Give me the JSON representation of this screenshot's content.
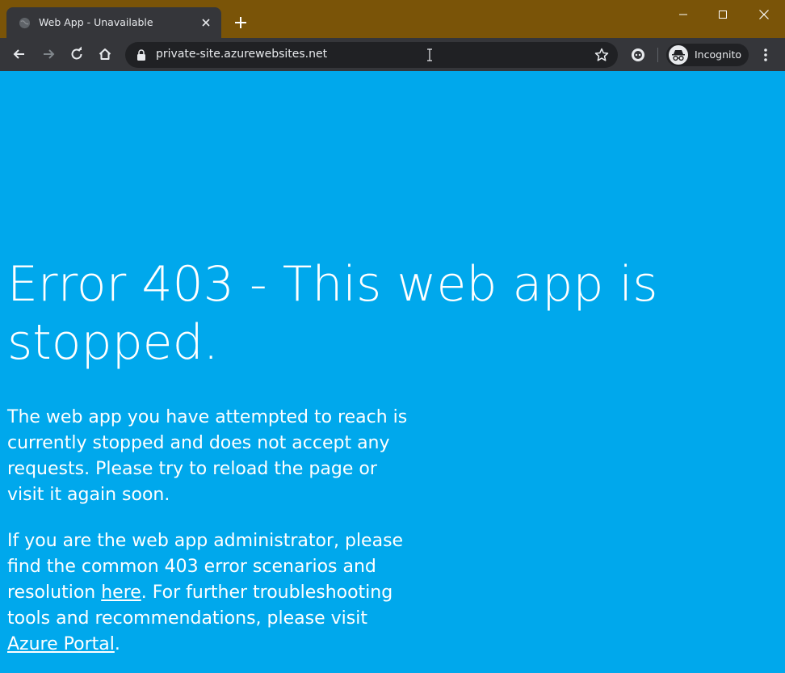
{
  "browser": {
    "tab_title": "Web App - Unavailable",
    "url": "private-site.azurewebsites.net",
    "profile_label": "Incognito"
  },
  "page": {
    "heading": "Error 403 - This web app is stopped.",
    "paragraph1": "The web app you have attempted to reach is currently stopped and does not accept any requests. Please try to reload the page or visit it again soon.",
    "paragraph2": {
      "part1": "If you are the web app administrator, please find the common 403 error scenarios and resolution ",
      "link1": "here",
      "part2": ". For further troubleshooting tools and recommendations, please visit ",
      "link2": "Azure Portal",
      "part3": "."
    }
  },
  "colors": {
    "titlebar": "#7a5408",
    "toolbar": "#35363a",
    "page_background": "#00a8ec",
    "text": "#ffffff"
  }
}
